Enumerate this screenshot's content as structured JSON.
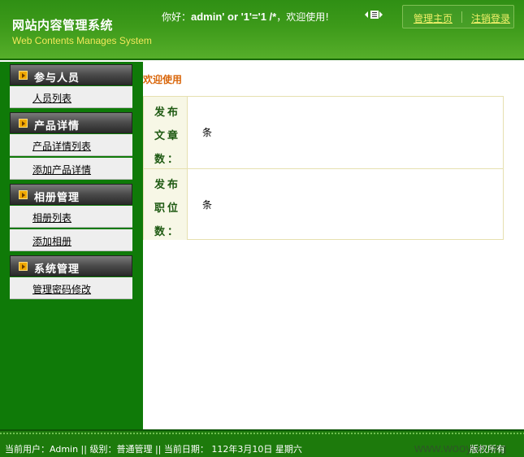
{
  "header": {
    "title": "网站内容管理系统",
    "subtitle": "Web Contents Manages System",
    "greeting_prefix": "你好：",
    "username": "admin' or '1'='1 /*",
    "greeting_suffix": "，欢迎使用!",
    "links": {
      "home": "管理主页",
      "logout": "注销登录"
    }
  },
  "sidebar": {
    "sections": [
      {
        "title": "参与人员",
        "items": [
          "人员列表"
        ]
      },
      {
        "title": "产品详情",
        "items": [
          "产品详情列表",
          "添加产品详情"
        ]
      },
      {
        "title": "相册管理",
        "items": [
          "相册列表",
          "添加相册"
        ]
      },
      {
        "title": "系统管理",
        "items": [
          "管理密码修改"
        ]
      }
    ]
  },
  "main": {
    "welcome": "欢迎使用",
    "stats": [
      {
        "label": "发布文章数：",
        "value": "条"
      },
      {
        "label": "发布职位数：",
        "value": "条"
      }
    ]
  },
  "footer": {
    "info": "当前用户：Admin || 级别：普通管理 || 当前日期： 112年3月10日 星期六",
    "copyright": "版权所有"
  },
  "watermark": "www.wooyun.org",
  "colors": {
    "header_green": "#3d9a1a",
    "sidebar_green": "#0f7a08",
    "welcome_orange": "#d9660a",
    "link_yellow": "#f2f06a"
  }
}
